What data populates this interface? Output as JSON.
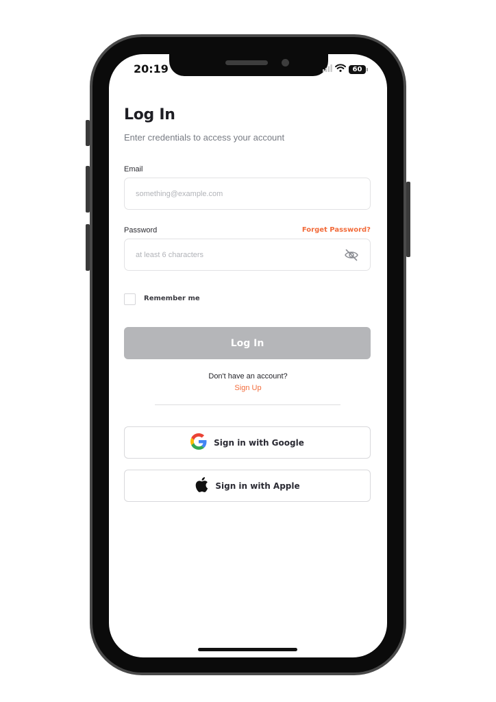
{
  "status_bar": {
    "time": "20:19",
    "battery": "60"
  },
  "screen": {
    "title": "Log In",
    "subtitle": "Enter credentials to access your account"
  },
  "email": {
    "label": "Email",
    "placeholder": "something@example.com",
    "value": ""
  },
  "password": {
    "label": "Password",
    "placeholder": "at least 6 characters",
    "value": "",
    "forgot_label": "Forget Password?",
    "visibility_icon": "eye-off-icon"
  },
  "remember": {
    "label": "Remember me",
    "checked": false
  },
  "login_button": {
    "label": "Log In"
  },
  "signup_prompt": {
    "text": "Don't have an account?",
    "link": "Sign Up"
  },
  "social": {
    "google_label": "Sign in with Google",
    "apple_label": "Sign in with Apple"
  },
  "colors": {
    "accent": "#f26b3a",
    "disabled_button": "#b5b6b9",
    "title_text": "#1e1e24",
    "phone_frame": "#0b0b0b"
  }
}
